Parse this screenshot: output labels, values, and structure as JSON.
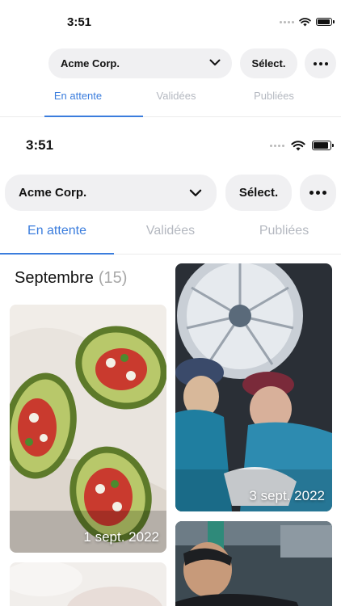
{
  "background_screen": {
    "status_time": "3:51",
    "company_select": "Acme Corp.",
    "select_label": "Sélect.",
    "tabs": [
      {
        "label": "En attente",
        "active": true
      },
      {
        "label": "Validées",
        "active": false
      },
      {
        "label": "Publiées",
        "active": false
      }
    ]
  },
  "status": {
    "time": "3:51",
    "battery_level": 0.9
  },
  "toolbar": {
    "company_select": "Acme Corp.",
    "select_label": "Sélect."
  },
  "tabs": [
    {
      "label": "En attente",
      "active": true
    },
    {
      "label": "Validées",
      "active": false
    },
    {
      "label": "Publiées",
      "active": false
    }
  ],
  "section": {
    "month": "Septembre",
    "count": "(15)"
  },
  "photos": [
    {
      "subject": "stuffed avocado halves with tomato salad",
      "date": "1 sept. 2022"
    },
    {
      "subject": "surgeons operating under surgical lights",
      "date": "3 sept. 2022"
    },
    {
      "subject": "partially visible photo",
      "date": ""
    },
    {
      "subject": "mechanic in workshop",
      "date": ""
    }
  ],
  "colors": {
    "accent": "#3b7ddd",
    "pill_bg": "#f0f0f2",
    "tab_inactive": "#b4b8c0",
    "count_gray": "#a7a7a7"
  },
  "icons": {
    "signal": "signal-dots-icon",
    "wifi": "wifi-icon",
    "battery": "battery-icon",
    "dropdown": "chevron-down-icon",
    "more": "more-horizontal-icon"
  }
}
